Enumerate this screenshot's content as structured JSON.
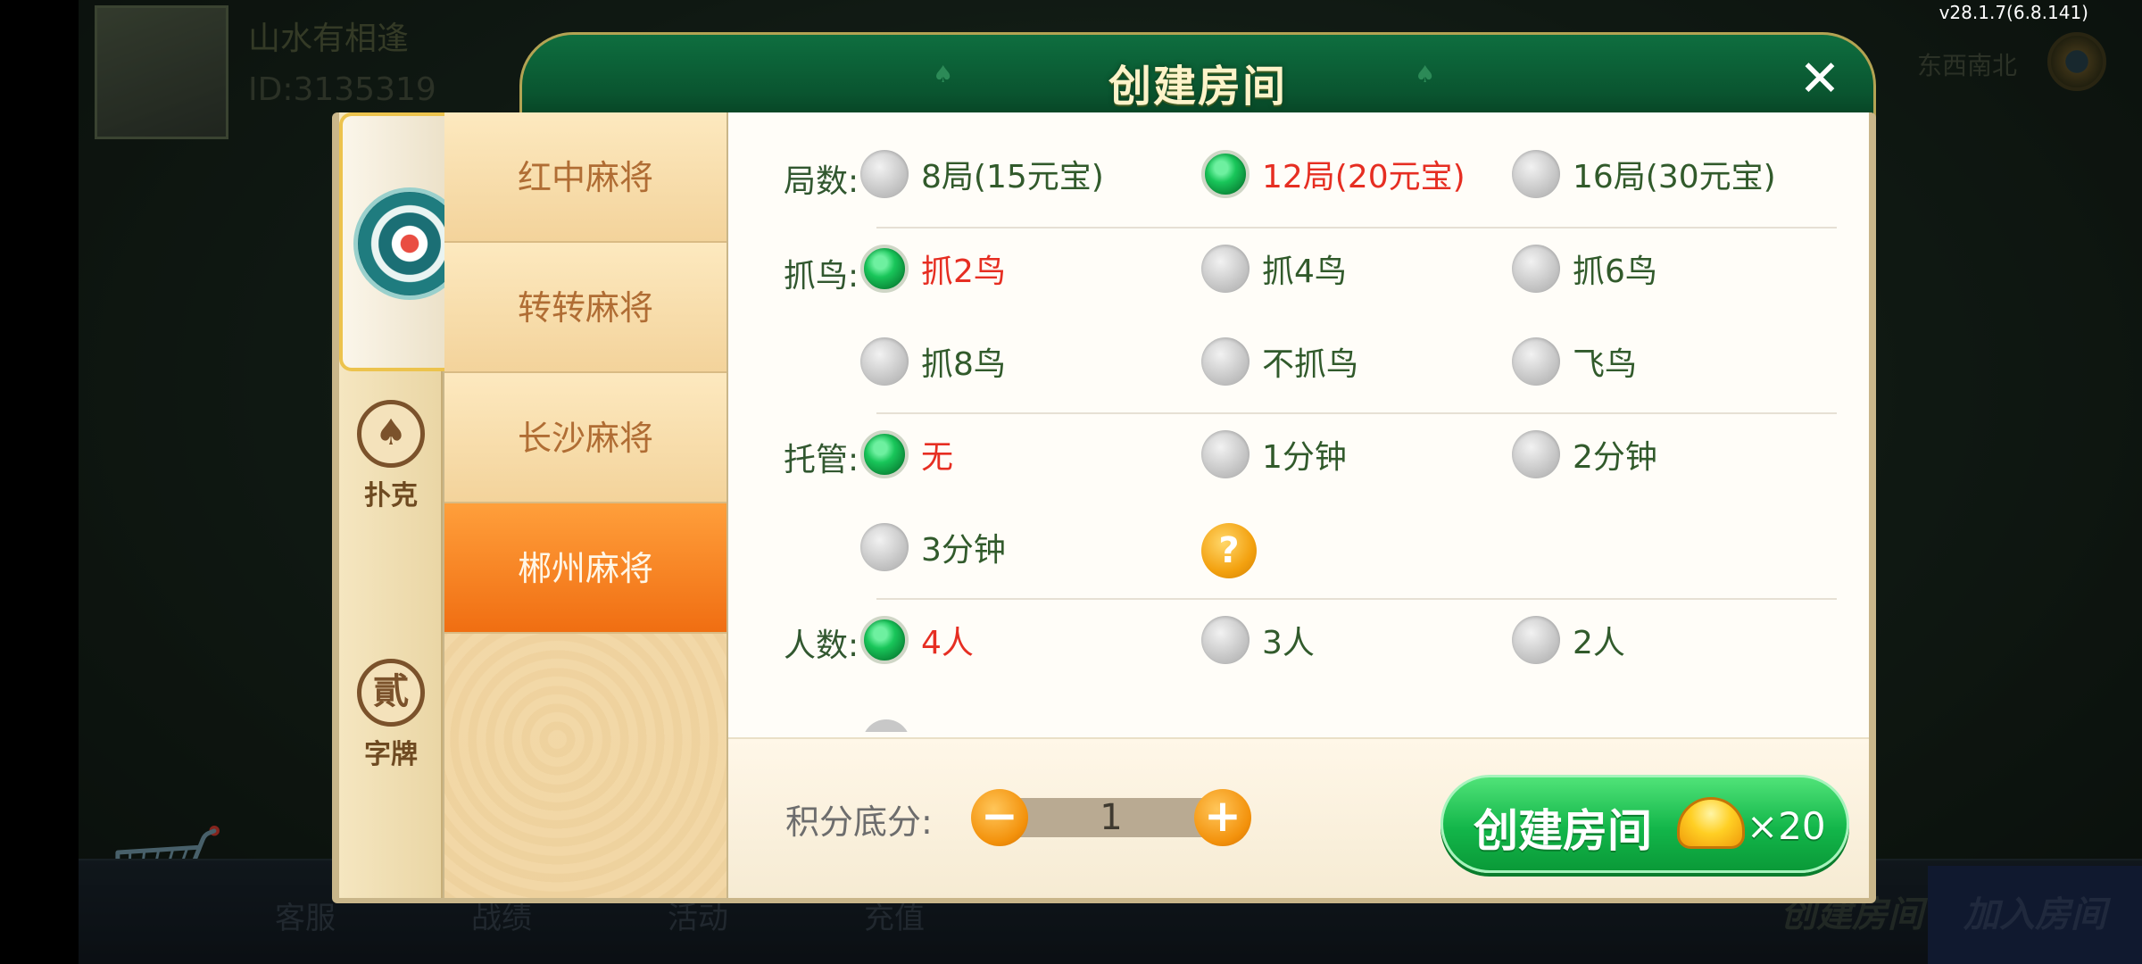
{
  "status": {
    "version": "v28.1.7(6.8.141)"
  },
  "lobby": {
    "player_name": "山水有相逢",
    "player_id": "ID:3135319",
    "top_right_text": "东西南北",
    "bottom_items": [
      "客服",
      "战绩",
      "活动",
      "充值"
    ],
    "create_room": "创建房间",
    "join_room": "加入房间"
  },
  "dialog": {
    "title": "创建房间",
    "close_icon": "close-icon",
    "categories": [
      {
        "label": "",
        "icon": "mahjong-emblem-icon",
        "active": true
      },
      {
        "label": "扑克",
        "icon": "spade-icon",
        "glyph": "♠"
      },
      {
        "label": "字牌",
        "icon": "zipai-icon",
        "glyph": "貳"
      }
    ],
    "games": [
      {
        "label": "红中麻将",
        "selected": false
      },
      {
        "label": "转转麻将",
        "selected": false
      },
      {
        "label": "长沙麻将",
        "selected": false
      },
      {
        "label": "郴州麻将",
        "selected": true
      }
    ],
    "options": {
      "rounds": {
        "label": "局数:",
        "choices": [
          {
            "text": "8局(15元宝)",
            "selected": false
          },
          {
            "text": "12局(20元宝)",
            "selected": true
          },
          {
            "text": "16局(30元宝)",
            "selected": false
          }
        ]
      },
      "birds": {
        "label": "抓鸟:",
        "choices": [
          {
            "text": "抓2鸟",
            "selected": true
          },
          {
            "text": "抓4鸟",
            "selected": false
          },
          {
            "text": "抓6鸟",
            "selected": false
          },
          {
            "text": "抓8鸟",
            "selected": false
          },
          {
            "text": "不抓鸟",
            "selected": false
          },
          {
            "text": "飞鸟",
            "selected": false
          }
        ]
      },
      "auto_play": {
        "label": "托管:",
        "choices": [
          {
            "text": "无",
            "selected": true
          },
          {
            "text": "1分钟",
            "selected": false
          },
          {
            "text": "2分钟",
            "selected": false
          },
          {
            "text": "3分钟",
            "selected": false
          }
        ],
        "help_icon": "help-icon",
        "help_glyph": "?"
      },
      "players": {
        "label": "人数:",
        "choices": [
          {
            "text": "4人",
            "selected": true
          },
          {
            "text": "3人",
            "selected": false
          },
          {
            "text": "2人",
            "selected": false
          }
        ]
      }
    },
    "base_score": {
      "label": "积分底分:",
      "value": "1",
      "minus": "−",
      "plus": "+"
    },
    "create_button": {
      "label": "创建房间",
      "cost": "×20",
      "currency_icon": "gold-ingot-icon"
    }
  },
  "colors": {
    "header_green": "#0a5530",
    "selected_text": "#e62e22",
    "option_text": "#315a2b",
    "selected_game": "#f06e12",
    "create_button": "#13b64a"
  }
}
